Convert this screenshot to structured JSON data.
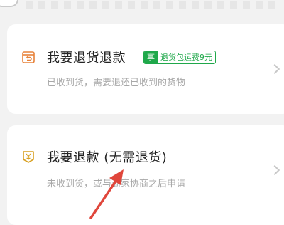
{
  "options": {
    "return_refund": {
      "title": "我要退货退款",
      "subtitle": "已收到货，需要退还已收到的货物",
      "badge_tag": "享",
      "badge_text": "退货包运费9元",
      "icon": "return-box-icon"
    },
    "refund_only": {
      "title": "我要退款 (无需退货)",
      "subtitle": "未收到货，或与商家协商之后申请",
      "icon": "refund-yuan-icon"
    }
  },
  "colors": {
    "accent_green": "#1fa84a",
    "icon_orange": "#e7823a",
    "icon_gold": "#d8a021",
    "annotation_arrow": "#e0463b"
  }
}
